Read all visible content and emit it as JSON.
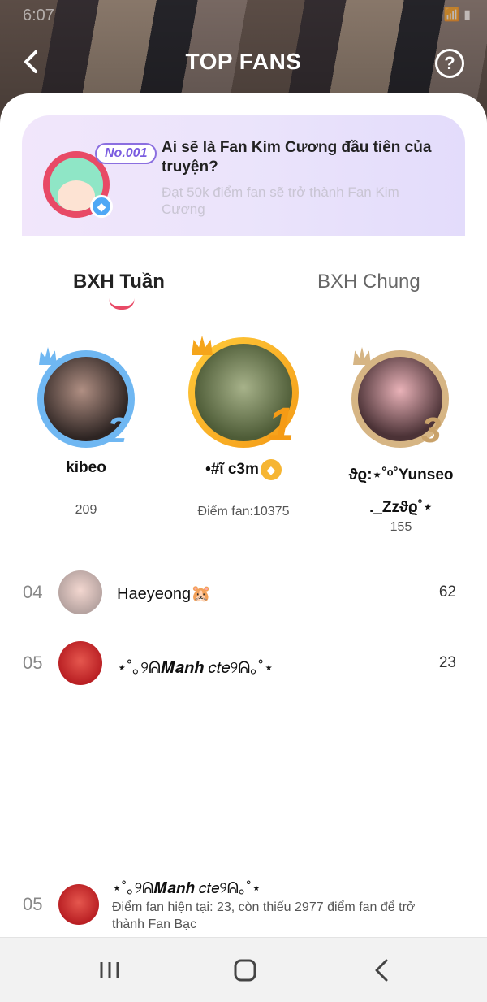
{
  "status": {
    "time": "6:07",
    "icons": "📶 ▮"
  },
  "header": {
    "title": "TOP FANS"
  },
  "banner": {
    "badge": "No.001",
    "title": "Ai sẽ là Fan Kim Cương đầu tiên của truyện?",
    "subtitle": "Đạt 50k điểm fan sẽ trở thành Fan Kim Cương"
  },
  "tabs": [
    {
      "label": "BXH Tuần",
      "active": true
    },
    {
      "label": "BXH Chung",
      "active": false
    }
  ],
  "podium": {
    "first": {
      "rank": "1",
      "name": "•#ῖ c3m",
      "score": "Điểm fan:10375",
      "badge_icon": "coin-icon"
    },
    "second": {
      "rank": "2",
      "name": "kibeo",
      "score": "209"
    },
    "third": {
      "rank": "3",
      "name": "ϑϱ:⋆˚ᵒ˚Yunseo ._Zzϑϱ˚⋆",
      "score": "155"
    }
  },
  "list": [
    {
      "rank": "04",
      "name": "Haeyeong🐹",
      "score": "62"
    },
    {
      "rank": "05",
      "name": "⋆˚｡୨ᕱ𝑴𝒂𝒏𝒉 𝑐𝑡𝑒୨ᕱ｡˚⋆",
      "score": "23"
    }
  ],
  "my_rank": {
    "rank": "05",
    "name": "⋆˚｡୨ᕱ𝑴𝒂𝒏𝒉 𝑐𝑡𝑒୨ᕱ｡˚⋆",
    "desc": "Điểm fan hiện tại: 23, còn thiếu 2977 điểm fan để trở thành Fan Bạc"
  },
  "colors": {
    "accent": "#e84a66",
    "gold": "#f59b15",
    "silver": "#6fb7f2",
    "bronze": "#d6b584"
  }
}
